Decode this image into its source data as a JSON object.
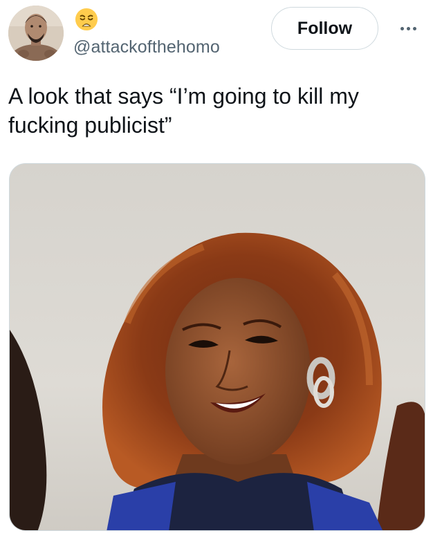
{
  "tweet": {
    "author": {
      "display_name_icon": "weary-face-emoji-icon",
      "handle": "@attackofthehomo",
      "avatar_icon": "avatar"
    },
    "follow_label": "Follow",
    "more_icon": "more-options-icon",
    "text": "A look that says “I’m going to kill my fucking publicist”",
    "media": {
      "type": "photo",
      "icon": "photo-image"
    }
  },
  "colors": {
    "text_primary": "#0f1419",
    "text_secondary": "#536471",
    "border": "#cfd9de",
    "background": "#ffffff"
  }
}
